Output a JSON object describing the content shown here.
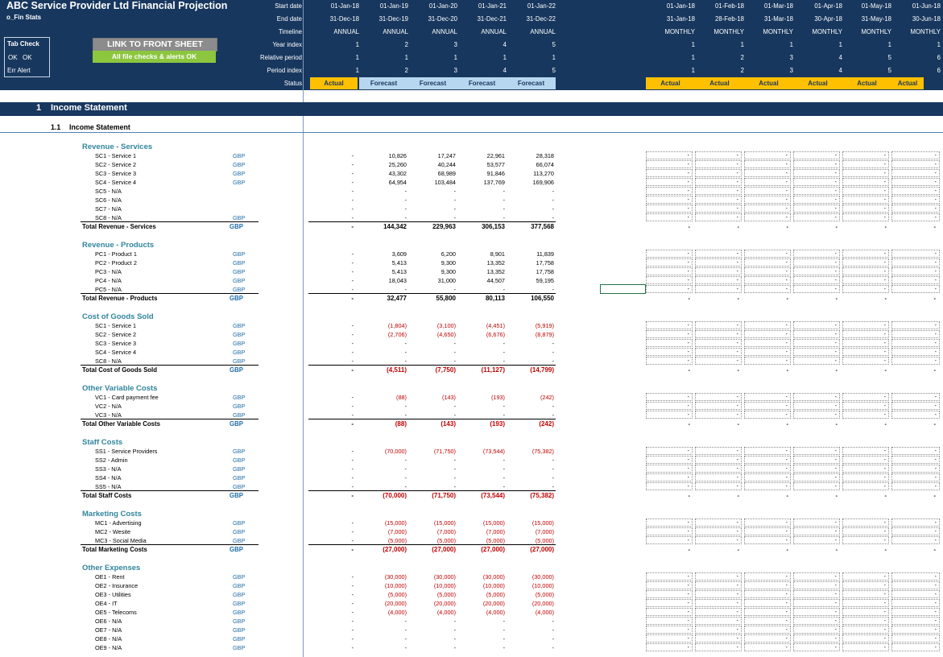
{
  "header": {
    "title": "ABC Service Provider Ltd Financial Projection",
    "subtitle": "o_Fin Stats",
    "tab_check": {
      "label": "Tab Check",
      "ok1": "OK",
      "ok2": "OK",
      "err": "Err Alert"
    },
    "link_button": "LINK TO FRONT SHEET",
    "checks_ok": "All file checks & alerts OK",
    "row_labels": [
      "Start date",
      "End date",
      "Timeline",
      "Year index",
      "Relative period",
      "Period index",
      "Status"
    ],
    "annual": {
      "start": [
        "01-Jan-18",
        "01-Jan-19",
        "01-Jan-20",
        "01-Jan-21",
        "01-Jan-22"
      ],
      "end": [
        "31-Dec-18",
        "31-Dec-19",
        "31-Dec-20",
        "31-Dec-21",
        "31-Dec-22"
      ],
      "timeline": [
        "ANNUAL",
        "ANNUAL",
        "ANNUAL",
        "ANNUAL",
        "ANNUAL"
      ],
      "year": [
        "1",
        "2",
        "3",
        "4",
        "5"
      ],
      "relative": [
        "1",
        "1",
        "1",
        "1",
        "1"
      ],
      "period": [
        "1",
        "2",
        "3",
        "4",
        "5"
      ],
      "status": [
        "Actual",
        "Forecast",
        "Forecast",
        "Forecast",
        "Forecast"
      ]
    },
    "monthly": {
      "start": [
        "01-Jan-18",
        "01-Feb-18",
        "01-Mar-18",
        "01-Apr-18",
        "01-May-18",
        "01-Jun-18"
      ],
      "end": [
        "31-Jan-18",
        "28-Feb-18",
        "31-Mar-18",
        "30-Apr-18",
        "31-May-18",
        "30-Jun-18"
      ],
      "timeline": [
        "MONTHLY",
        "MONTHLY",
        "MONTHLY",
        "MONTHLY",
        "MONTHLY",
        "MONTHLY"
      ],
      "year": [
        "1",
        "1",
        "1",
        "1",
        "1",
        "1"
      ],
      "relative": [
        "1",
        "2",
        "3",
        "4",
        "5",
        "6"
      ],
      "period": [
        "1",
        "2",
        "3",
        "4",
        "5",
        "6"
      ],
      "status": [
        "Actual",
        "Actual",
        "Actual",
        "Actual",
        "Actual",
        "Actual"
      ]
    }
  },
  "section": {
    "number": "1",
    "title": "Income Statement"
  },
  "subsection": {
    "number": "1.1",
    "title": "Income Statement"
  },
  "groups": [
    {
      "title": "Revenue - Services",
      "rows": [
        {
          "label": "SC1 - Service 1",
          "unit": "GBP",
          "values": [
            "-",
            "10,826",
            "17,247",
            "22,961",
            "28,318"
          ]
        },
        {
          "label": "SC2 - Service 2",
          "unit": "GBP",
          "values": [
            "-",
            "25,260",
            "40,244",
            "53,577",
            "66,074"
          ]
        },
        {
          "label": "SC3 - Service 3",
          "unit": "GBP",
          "values": [
            "-",
            "43,302",
            "68,989",
            "91,846",
            "113,270"
          ]
        },
        {
          "label": "SC4 - Service 4",
          "unit": "GBP",
          "values": [
            "-",
            "64,954",
            "103,484",
            "137,769",
            "169,906"
          ]
        },
        {
          "label": "SC5 - N/A",
          "unit": "",
          "values": [
            "-",
            "-",
            "-",
            "-",
            "-"
          ]
        },
        {
          "label": "SC6 - N/A",
          "unit": "",
          "values": [
            "-",
            "-",
            "-",
            "-",
            "-"
          ]
        },
        {
          "label": "SC7 - N/A",
          "unit": "",
          "values": [
            "-",
            "-",
            "-",
            "-",
            "-"
          ]
        },
        {
          "label": "SC8 - N/A",
          "unit": "GBP",
          "values": [
            "-",
            "-",
            "-",
            "-",
            "-"
          ]
        }
      ],
      "total": {
        "label": "Total Revenue - Services",
        "unit": "GBP",
        "values": [
          "-",
          "144,342",
          "229,963",
          "306,153",
          "377,568"
        ]
      }
    },
    {
      "title": "Revenue - Products",
      "rows": [
        {
          "label": "PC1 - Product 1",
          "unit": "GBP",
          "values": [
            "-",
            "3,609",
            "6,200",
            "8,901",
            "11,839"
          ]
        },
        {
          "label": "PC2 - Product 2",
          "unit": "GBP",
          "values": [
            "-",
            "5,413",
            "9,300",
            "13,352",
            "17,758"
          ]
        },
        {
          "label": "PC3 - N/A",
          "unit": "GBP",
          "values": [
            "-",
            "5,413",
            "9,300",
            "13,352",
            "17,758"
          ]
        },
        {
          "label": "PC4 - N/A",
          "unit": "GBP",
          "values": [
            "-",
            "18,043",
            "31,000",
            "44,507",
            "59,195"
          ]
        },
        {
          "label": "PC5 - N/A",
          "unit": "GBP",
          "values": [
            "-",
            "-",
            "-",
            "-",
            "-"
          ]
        }
      ],
      "total": {
        "label": "Total Revenue - Products",
        "unit": "GBP",
        "values": [
          "-",
          "32,477",
          "55,800",
          "80,113",
          "106,550"
        ]
      }
    },
    {
      "title": "Cost of Goods Sold",
      "rows": [
        {
          "label": "SC1 - Service 1",
          "unit": "GBP",
          "values": [
            "-",
            "(1,804)",
            "(3,100)",
            "(4,451)",
            "(5,919)"
          ]
        },
        {
          "label": "SC2 - Service 2",
          "unit": "GBP",
          "values": [
            "-",
            "(2,706)",
            "(4,650)",
            "(6,676)",
            "(8,879)"
          ]
        },
        {
          "label": "SC3 - Service 3",
          "unit": "GBP",
          "values": [
            "-",
            "-",
            "-",
            "-",
            "-"
          ]
        },
        {
          "label": "SC4 - Service 4",
          "unit": "GBP",
          "values": [
            "-",
            "-",
            "-",
            "-",
            "-"
          ]
        },
        {
          "label": "SC8 - N/A",
          "unit": "GBP",
          "values": [
            "-",
            "-",
            "-",
            "-",
            "-"
          ]
        }
      ],
      "total": {
        "label": "Total Cost of Goods Sold",
        "unit": "GBP",
        "values": [
          "-",
          "(4,511)",
          "(7,750)",
          "(11,127)",
          "(14,799)"
        ]
      }
    },
    {
      "title": "Other Variable Costs",
      "rows": [
        {
          "label": "VC1 - Card payment fee",
          "unit": "GBP",
          "values": [
            "-",
            "(88)",
            "(143)",
            "(193)",
            "(242)"
          ]
        },
        {
          "label": "VC2 - N/A",
          "unit": "GBP",
          "values": [
            "-",
            "-",
            "-",
            "-",
            "-"
          ]
        },
        {
          "label": "VC3 - N/A",
          "unit": "GBP",
          "values": [
            "-",
            "-",
            "-",
            "-",
            "-"
          ]
        }
      ],
      "total": {
        "label": "Total Other Variable Costs",
        "unit": "GBP",
        "values": [
          "-",
          "(88)",
          "(143)",
          "(193)",
          "(242)"
        ]
      }
    },
    {
      "title": "Staff Costs",
      "rows": [
        {
          "label": "SS1 - Service Providers",
          "unit": "GBP",
          "values": [
            "-",
            "(70,000)",
            "(71,750)",
            "(73,544)",
            "(75,382)"
          ]
        },
        {
          "label": "SS2 - Admin",
          "unit": "GBP",
          "values": [
            "-",
            "-",
            "-",
            "-",
            "-"
          ]
        },
        {
          "label": "SS3 - N/A",
          "unit": "GBP",
          "values": [
            "-",
            "-",
            "-",
            "-",
            "-"
          ]
        },
        {
          "label": "SS4 - N/A",
          "unit": "GBP",
          "values": [
            "-",
            "-",
            "-",
            "-",
            "-"
          ]
        },
        {
          "label": "SS5 - N/A",
          "unit": "GBP",
          "values": [
            "-",
            "-",
            "-",
            "-",
            "-"
          ]
        }
      ],
      "total": {
        "label": "Total Staff Costs",
        "unit": "GBP",
        "values": [
          "-",
          "(70,000)",
          "(71,750)",
          "(73,544)",
          "(75,382)"
        ]
      }
    },
    {
      "title": "Marketing Costs",
      "rows": [
        {
          "label": "MC1 - Advertising",
          "unit": "GBP",
          "values": [
            "-",
            "(15,000)",
            "(15,000)",
            "(15,000)",
            "(15,000)"
          ]
        },
        {
          "label": "MC2 - Wesite",
          "unit": "GBP",
          "values": [
            "-",
            "(7,000)",
            "(7,000)",
            "(7,000)",
            "(7,000)"
          ]
        },
        {
          "label": "MC3 - Social Media",
          "unit": "GBP",
          "values": [
            "-",
            "(5,000)",
            "(5,000)",
            "(5,000)",
            "(5,000)"
          ]
        }
      ],
      "total": {
        "label": "Total Marketing Costs",
        "unit": "GBP",
        "values": [
          "-",
          "(27,000)",
          "(27,000)",
          "(27,000)",
          "(27,000)"
        ]
      }
    },
    {
      "title": "Other Expenses",
      "rows": [
        {
          "label": "OE1 - Rent",
          "unit": "GBP",
          "values": [
            "-",
            "(30,000)",
            "(30,000)",
            "(30,000)",
            "(30,000)"
          ]
        },
        {
          "label": "OE2 - Insurance",
          "unit": "GBP",
          "values": [
            "-",
            "(10,000)",
            "(10,000)",
            "(10,000)",
            "(10,000)"
          ]
        },
        {
          "label": "OE3 - Utilities",
          "unit": "GBP",
          "values": [
            "-",
            "(5,000)",
            "(5,000)",
            "(5,000)",
            "(5,000)"
          ]
        },
        {
          "label": "OE4 - IT",
          "unit": "GBP",
          "values": [
            "-",
            "(20,000)",
            "(20,000)",
            "(20,000)",
            "(20,000)"
          ]
        },
        {
          "label": "OE5 - Telecoms",
          "unit": "GBP",
          "values": [
            "-",
            "(4,000)",
            "(4,000)",
            "(4,000)",
            "(4,000)"
          ]
        },
        {
          "label": "OE6 - N/A",
          "unit": "GBP",
          "values": [
            "-",
            "-",
            "-",
            "-",
            "-"
          ]
        },
        {
          "label": "OE7 - N/A",
          "unit": "GBP",
          "values": [
            "-",
            "-",
            "-",
            "-",
            "-"
          ]
        },
        {
          "label": "OE8 - N/A",
          "unit": "GBP",
          "values": [
            "-",
            "-",
            "-",
            "-",
            "-"
          ]
        },
        {
          "label": "OE9 - N/A",
          "unit": "GBP",
          "values": [
            "-",
            "-",
            "-",
            "-",
            "-"
          ]
        }
      ],
      "total": null
    }
  ],
  "monthly_placeholder": "-",
  "colors": {
    "navy": "#17375e",
    "actual": "#ffc000",
    "forecast": "#b7d7f0",
    "teal": "#31859c",
    "negative": "#c00000",
    "gbp": "#1f6ea8",
    "ok_green": "#8cc63f"
  }
}
